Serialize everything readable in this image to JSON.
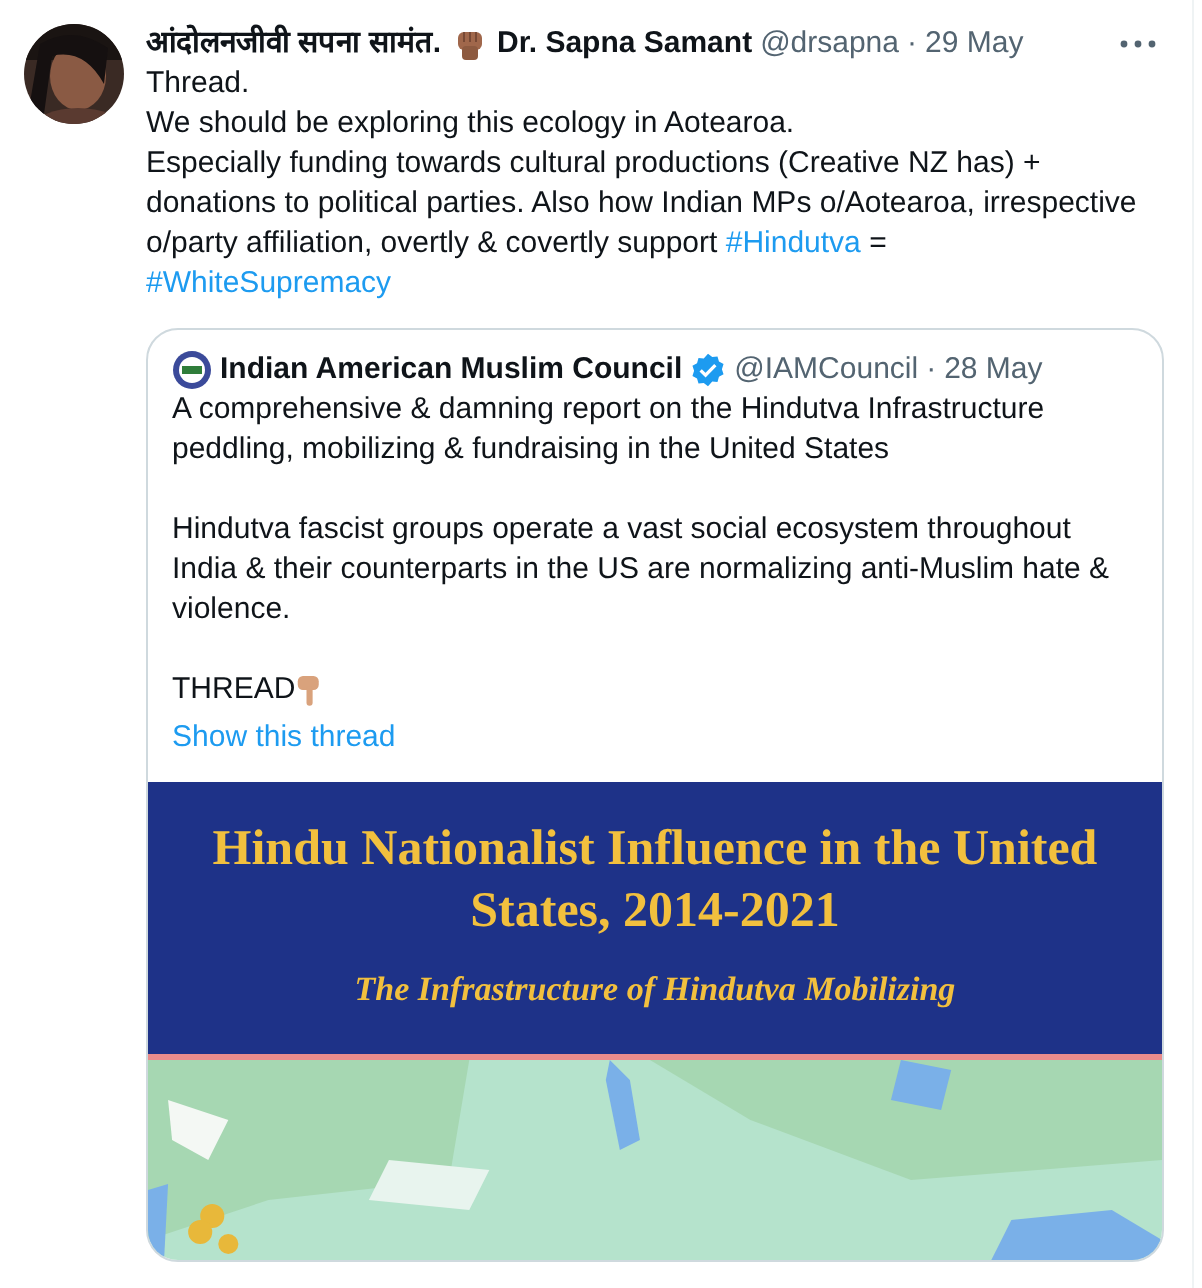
{
  "tweet": {
    "author": {
      "name_prefix": "आंदोलनजीवी सपना सामंत.",
      "name": "Dr. Sapna Samant",
      "handle": "@drsapna",
      "separator": "·",
      "time": "29 May"
    },
    "text": [
      {
        "kind": "plain",
        "text": "Thread.\nWe should be exploring this ecology in Aotearoa.\nEspecially funding towards cultural productions (Creative NZ has) +\ndonations to political parties. Also how Indian MPs o/Aotearoa, irrespective\no/party affiliation, overtly & covertly support "
      },
      {
        "kind": "hashtag",
        "text": "#Hindutva"
      },
      {
        "kind": "plain",
        "text": " =\n"
      },
      {
        "kind": "hashtag",
        "text": "#WhiteSupremacy"
      }
    ],
    "quote": {
      "author": {
        "name": "Indian American Muslim Council",
        "verified": true,
        "handle": "@IAMCouncil",
        "separator": "·",
        "time": "28 May"
      },
      "text": "A comprehensive & damning report on the Hindutva Infrastructure\npeddling, mobilizing & fundraising in the United States\n\nHindutva fascist groups operate a vast social ecosystem throughout\nIndia & their counterparts in the US are normalizing anti-Muslim hate &\nviolence.",
      "closing": "THREAD",
      "link": "Show this thread",
      "media": {
        "title": "Hindu Nationalist Influence in the United States, 2014-2021",
        "subtitle": "The Infrastructure of Hindutva Mobilizing"
      }
    }
  }
}
